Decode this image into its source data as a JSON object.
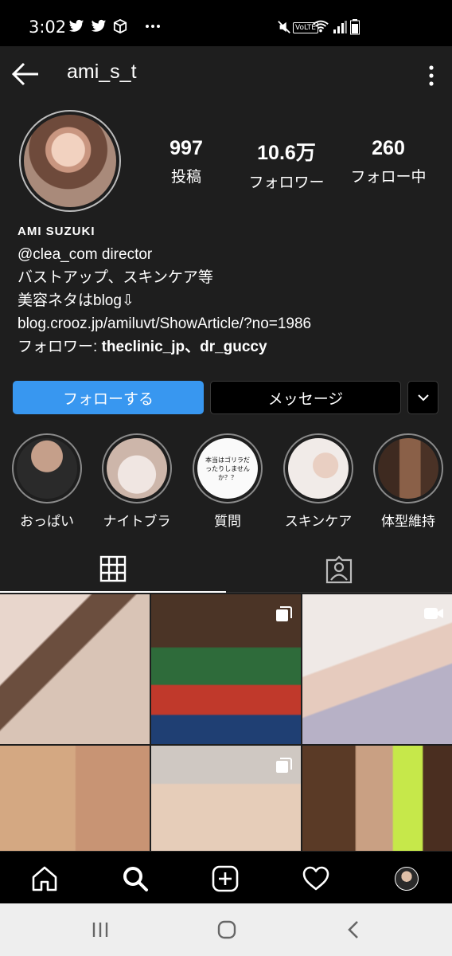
{
  "status_bar": {
    "time": "3:02",
    "left_icons": [
      "twitter-icon",
      "twitter-icon",
      "box-icon",
      "more-dots-icon"
    ],
    "right_icons": [
      "mute-icon",
      "volte-icon",
      "wifi-icon",
      "signal-icon",
      "battery-icon"
    ],
    "volte_label": "VoLTE"
  },
  "header": {
    "username": "ami_s_t"
  },
  "profile": {
    "stats": [
      {
        "value": "997",
        "label": "投稿"
      },
      {
        "value": "10.6万",
        "label": "フォロワー"
      },
      {
        "value": "260",
        "label": "フォロー中"
      }
    ],
    "name": "AMI SUZUKI",
    "bio_lines": [
      "@clea_com director",
      "バストアップ、スキンケア等",
      "美容ネタはblog⇩",
      "blog.crooz.jp/amiluvt/ShowArticle/?no=1986"
    ],
    "followers_prefix": "フォロワー: ",
    "followers_names": "theclinic_jp、dr_guccy"
  },
  "buttons": {
    "follow": "フォローする",
    "message": "メッセージ"
  },
  "highlights": [
    {
      "label": "おっぱい",
      "color": "#7a6a62"
    },
    {
      "label": "ナイトブラ",
      "color": "#d9c7bd"
    },
    {
      "label": "質問",
      "text": "本当はゴリラだったりしませんか？？"
    },
    {
      "label": "スキンケア",
      "color": "#e6d8d2"
    },
    {
      "label": "体型維持",
      "color": "#6b4a3a"
    }
  ],
  "tabs": [
    "grid-icon",
    "tagged-icon"
  ],
  "posts": [
    {
      "color": "#c2b0aa",
      "badge": ""
    },
    {
      "color": "#5a3d2e",
      "badge": "multiple-icon"
    },
    {
      "color": "#d5cdc8",
      "badge": "video-icon"
    },
    {
      "color": "#caa590",
      "badge": ""
    },
    {
      "color": "#9e8f86",
      "badge": "multiple-icon"
    },
    {
      "color": "#8a6648",
      "badge": ""
    }
  ],
  "bottom_nav": [
    "home-icon",
    "search-icon",
    "add-post-icon",
    "heart-icon",
    "profile-avatar"
  ],
  "system_nav": [
    "recent-apps-icon",
    "home-button-icon",
    "back-button-icon"
  ]
}
